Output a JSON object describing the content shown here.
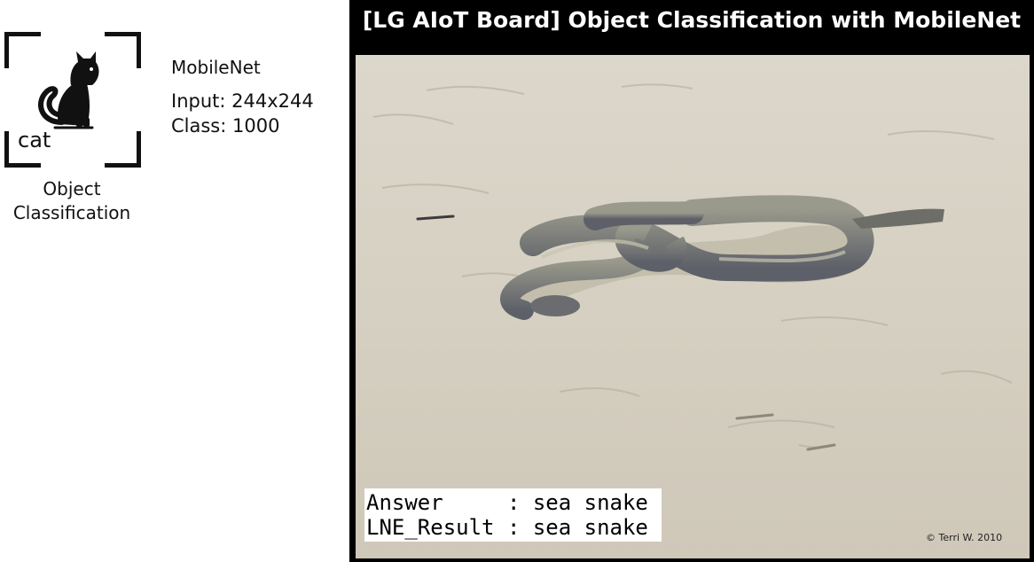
{
  "task": {
    "icon": "cat-icon",
    "icon_label": "cat",
    "title_line1": "Object",
    "title_line2": "Classification"
  },
  "model": {
    "name": "MobileNet",
    "input": "Input: 244x244",
    "classes": "Class: 1000"
  },
  "demo": {
    "title": "[LG AIoT Board] Object Classification with MobileNet",
    "photo_subject": "sea-snake-photo",
    "answer_line": "Answer     : sea snake",
    "result_line": "LNE_Result : sea snake",
    "credit": "© Terri W. 2010"
  }
}
